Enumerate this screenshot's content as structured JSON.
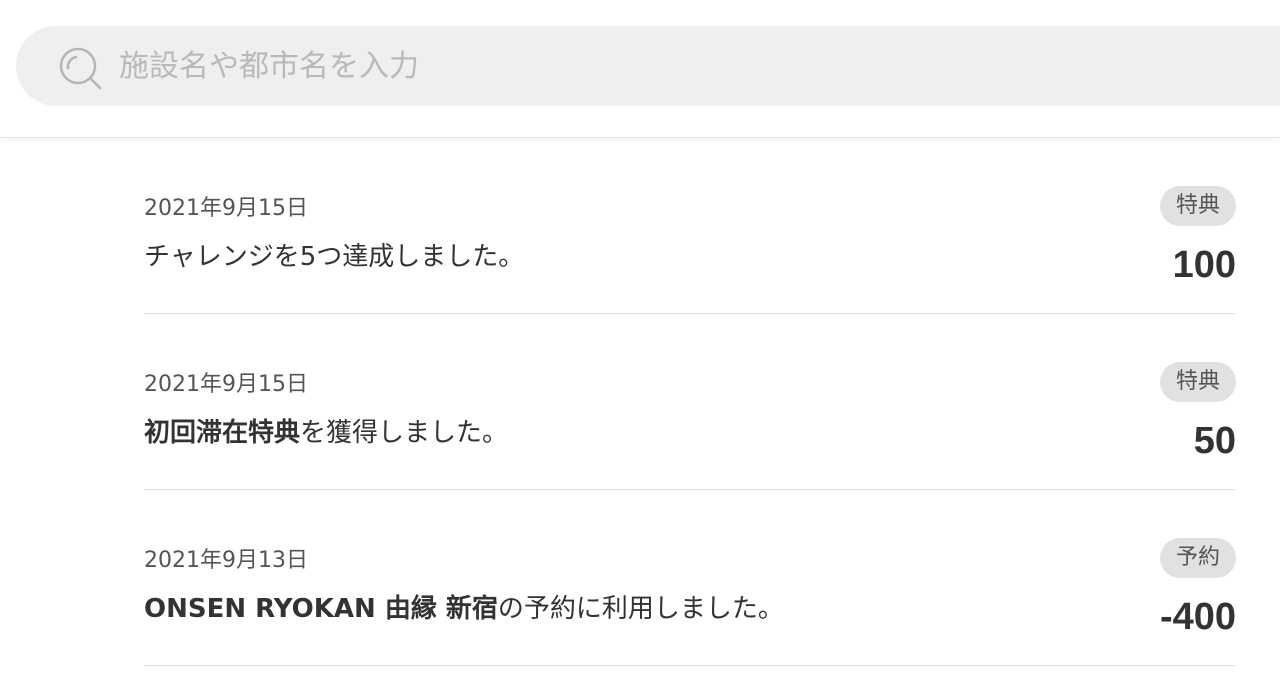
{
  "search": {
    "placeholder": "施設名や都市名を入力",
    "icon": "search-icon"
  },
  "entries": [
    {
      "date": "2021年9月15日",
      "desc_bold": "",
      "desc_text": "チャレンジを5つ達成しました。",
      "badge": "特典",
      "points": "100"
    },
    {
      "date": "2021年9月15日",
      "desc_bold": "初回滞在特典",
      "desc_text": "を獲得しました。",
      "badge": "特典",
      "points": "50"
    },
    {
      "date": "2021年9月13日",
      "desc_bold": "ONSEN RYOKAN 由縁 新宿",
      "desc_text": "の予約に利用しました。",
      "badge": "予約",
      "points": "-400"
    }
  ]
}
